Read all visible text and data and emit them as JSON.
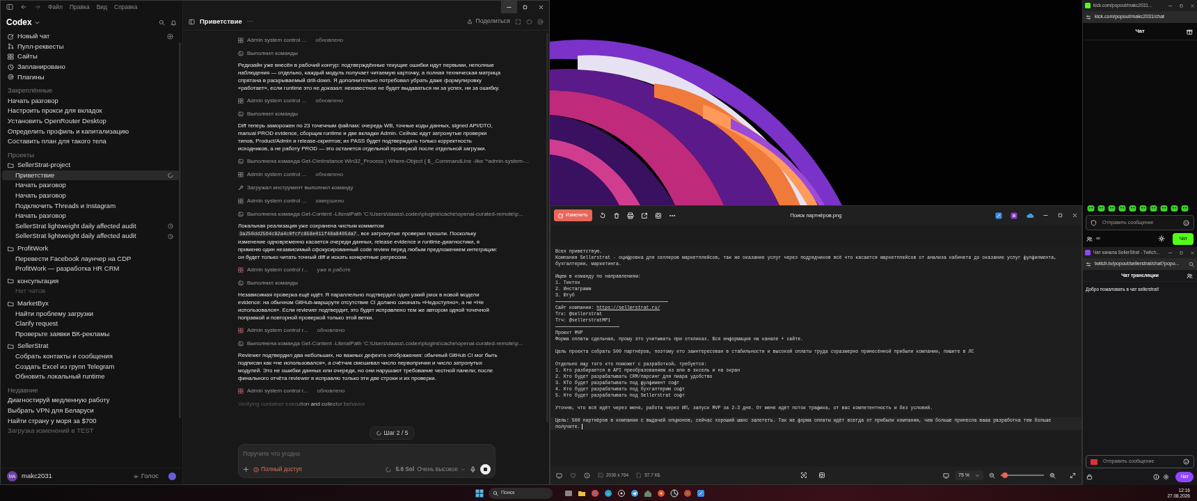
{
  "codex": {
    "menu": [
      "Файл",
      "Правка",
      "Вид",
      "Справка"
    ],
    "app_title": "Codex",
    "nav": [
      "Новый чат",
      "Пулл-реквесты",
      "Сайты",
      "Запланировано",
      "Плагины"
    ],
    "pinned": {
      "heading": "Закреплённые",
      "items": [
        {
          "label": "Начать разговор",
          "selected": false
        },
        {
          "label": "Настроить прокси для вкладок",
          "selected": false
        },
        {
          "label": "Установить OpenRouter Desktop",
          "selected": false
        },
        {
          "label": "Определить профиль и капитализацию",
          "selected": false
        },
        {
          "label": "Составить план для такого тела",
          "selected": false
        }
      ]
    },
    "projects": {
      "heading": "Проекты",
      "folders": [
        {
          "name": "SellerStrat-project",
          "children": [
            {
              "label": "Приветствие",
              "kind": "running",
              "selected": true
            },
            {
              "label": "Начать разговор",
              "kind": "chat",
              "selected": false
            },
            {
              "label": "Начать разговор",
              "kind": "chat",
              "selected": false
            },
            {
              "label": "Подключить Threads и Instagram",
              "kind": "chat",
              "selected": false
            },
            {
              "label": "Начать разговор",
              "kind": "chat",
              "selected": false
            },
            {
              "label": "SellerStrat lightweight daily affected audit",
              "kind": "scheduled",
              "selected": false
            },
            {
              "label": "SellerStrat lightweight daily affected audit",
              "kind": "scheduled",
              "selected": false
            }
          ]
        },
        {
          "name": "ProfitWork",
          "children": [
            {
              "label": "Перевести Facebook лаунчер на CDP",
              "kind": "chat",
              "selected": false
            },
            {
              "label": "ProfitWork — разработка HR CRM",
              "kind": "chat",
              "selected": false
            }
          ]
        },
        {
          "name": "консультация",
          "children": [
            {
              "label": "Нет чатов",
              "kind": "empty",
              "selected": false
            }
          ]
        },
        {
          "name": "MarketByx",
          "children": [
            {
              "label": "Найти проблему загрузки",
              "kind": "chat",
              "selected": false
            },
            {
              "label": "Clarify request",
              "kind": "chat",
              "selected": false
            },
            {
              "label": "Проверьте заявки ВК-рекламы",
              "kind": "chat",
              "selected": false
            }
          ]
        },
        {
          "name": "SellerStrat",
          "children": [
            {
              "label": "Собрать контакты и сообщения",
              "kind": "chat",
              "selected": false
            },
            {
              "label": "Создать Excel из групп Telegram",
              "kind": "chat",
              "selected": false
            },
            {
              "label": "Обновить локальный runtime",
              "kind": "chat",
              "selected": false
            }
          ]
        }
      ]
    },
    "recent": {
      "heading": "Недавние",
      "items": [
        {
          "label": "Диагностируй медленную работу",
          "kind": "chat",
          "selected": false
        },
        {
          "label": "Выбрать VPN для Беларуси",
          "kind": "chat",
          "selected": false
        },
        {
          "label": "Найти страну у моря за $700",
          "kind": "chat",
          "selected": false
        },
        {
          "label": "Загрузка изменений в TEST",
          "kind": "faded",
          "selected": false
        }
      ]
    },
    "user": {
      "initials": "MA",
      "name": "makc2031"
    },
    "voice": "Голос",
    "chat": {
      "title": "Приветствие",
      "more": "···",
      "share": "Поделиться",
      "messages": [
        {
          "kind": "tool",
          "label": "Admin system control ...",
          "status": "обновлено"
        },
        {
          "kind": "command",
          "label": "Выполнил команды"
        },
        {
          "kind": "text",
          "parts": [
            {
              "text": "Редизайн уже внесён в рабочий контур: подтверждённые текущие ошибки идут первыми, неполные наблюдения — отдельно, каждый модуль получает читаемую карточку, а полная техническая матрица спрятана в раскрываемый drill-down. Я дополнительно потребовал убрать даже формулировку «работает», если runtime это не доказал: неизвестное не будет выдаваться ни за успех, ни за ошибку.",
              "code": false
            }
          ]
        },
        {
          "kind": "tool",
          "label": "Admin system control ...",
          "status": "обновлено"
        },
        {
          "kind": "command",
          "label": "Выполнил команды"
        },
        {
          "kind": "text",
          "parts": [
            {
              "text": "Diff теперь заморожен по 23 точечным файлам: очередь WB, точные коды данных, signed API/DTO, manual PROD evidence, сборщик runtime и две вкладки Admin. Сейчас идут затронутые проверки типов, Product/Admin и release-скриптов; их PASS будет подтверждать только корректность исходников, а не работу PROD — это останется отдельной проверкой после отдельной загрузки.",
              "code": false
            }
          ]
        },
        {
          "kind": "command",
          "label": "Выполнена команда Get-CimInstance Win32_Process | Where-Object { $_.CommandLine -like '*admin-system-..."
        },
        {
          "kind": "tool",
          "label": "Admin system control ...",
          "status": "обновлено"
        },
        {
          "kind": "loader",
          "label": "Загружал инструмент выполнил команду"
        },
        {
          "kind": "tool",
          "label": "Admin system control ...",
          "status": "завершено"
        },
        {
          "kind": "command",
          "label": "Выполнена команда Get-Content -LiteralPath 'C:\\Users\\daass\\.codex\\plugins\\cache\\openai-curated-remote\\p..."
        },
        {
          "kind": "text",
          "parts": [
            {
              "text": "Локальная реализация уже сохранена чистым коммитом ",
              "code": false
            },
            {
              "text": "3a250dd2564c82a4c0fcfc858e011f48a8405da7",
              "code": true
            },
            {
              "text": ", все затронутые проверки прошли. Поскольку изменение одновременно касается очереди данных, release evidence и runtime-диагностики, я применю один независимый сфокусированный code review перед любым предложением интеграции: он будет только читать точный diff и искать конкретные регрессии.",
              "code": false
            }
          ]
        },
        {
          "kind": "tool",
          "label": "Admin system control r...",
          "status": "уже в работе"
        },
        {
          "kind": "command",
          "label": "Выполнил команды"
        },
        {
          "kind": "text",
          "parts": [
            {
              "text": "Независимая проверка ещё идёт. Я параллельно подтвердил один узкий риск в новой модели evidence: на обычном GitHub-маршруте отсутствие CI должно означать «Недоступно», а не «Не использовался». Если reviewer подтвердит, это будет исправлено тем же автором одной точечной поправкой и повторной проверкой только этой ветки.",
              "code": false
            }
          ]
        },
        {
          "kind": "tool",
          "label": "Admin system control r...",
          "status": "обновлено"
        },
        {
          "kind": "command",
          "label": "Выполнена команда Get-Content -LiteralPath 'C:\\Users\\daass\\.codex\\plugins\\cache\\openai-curated-remote\\p..."
        },
        {
          "kind": "text",
          "parts": [
            {
              "text": "Reviewer подтвердил два небольших, но важных дефекта отображения: обычный GitHub CI мог быть подписан как «не использовался», а счётчик смешивал число первопричин и число затронутых модулей. Это не ошибки данных или очереди, но они нарушают требование честной панели; после финального отчёта reviewer я исправлю только эти две строки и их проверки.",
              "code": false
            }
          ]
        },
        {
          "kind": "tool",
          "label": "Admin system control r...",
          "status": "обновлено"
        },
        {
          "kind": "status",
          "label": "Verifying container execution and collector behavior"
        }
      ],
      "step": "Шаг 2 / 5",
      "composer": {
        "placeholder": "Поручите что угодно",
        "access": "Полный доступ",
        "model": "5.6 Sol",
        "effort": "Очень высокое"
      }
    }
  },
  "photos": {
    "edit_button": "Изменить",
    "title": "Поиск партнёров.png",
    "blocks": [
      {
        "kind": "text",
        "lines": [
          {
            "text": "Всех приветствую."
          },
          {
            "text": "Компания Sellerstrat - оцифровка для селлеров маркетплейсов, так же оказание услуг через подрядчиков всё что касается маркетплейсов от анализа кабинета до оказание услуг фулфилмента, бухгалтерии, маркетинга."
          }
        ]
      },
      {
        "kind": "text",
        "lines": [
          {
            "text": "Ищем в команду по направлениям:"
          },
          {
            "text": "1. Тикток"
          },
          {
            "text": "2. Инстаграмм"
          },
          {
            "text": "3. Ютуб"
          }
        ]
      },
      {
        "kind": "rule"
      },
      {
        "kind": "text",
        "lines": [
          {
            "text": "Сайт компании: ",
            "link": "https://sellerstrat.ru/"
          },
          {
            "text": "Тгк: @sellerstrat"
          },
          {
            "text": "Тгч: @sellerstratMP1"
          }
        ]
      },
      {
        "kind": "rule"
      },
      {
        "kind": "text",
        "lines": [
          {
            "text": "Проект MVP"
          },
          {
            "text": "Форма оплаты сдельная, прошу это учитывать при откликах. Вся информация на канале + сайте."
          }
        ]
      },
      {
        "kind": "text",
        "lines": [
          {
            "text": "Цель проекта собрать 500 партнёров, поэтому кто заинтересован в стабильности и высокой оплаты труда соразмерно принесённой прибыли компании, пишите в ЛС"
          }
        ]
      },
      {
        "kind": "text",
        "lines": [
          {
            "text": "Отдельно ищу того кто поможет с разработкой, требуется:"
          },
          {
            "text": "1. Кто разбирается в API преобразованием из апи в эксель и на экран"
          },
          {
            "text": "2. Кто будет разрабатывать CRM/парсинг для пиара удобство"
          },
          {
            "text": "3. КТо будет разрабатывать под фулфимент софт"
          },
          {
            "text": "4. Кто будет разрабатывать под бухгалтерию софт"
          },
          {
            "text": "5. Кто будет разрабатывать под Sellerstrat софт"
          }
        ]
      },
      {
        "kind": "text",
        "lines": [
          {
            "text": "Уточню, что всё идёт через меня, работа через ИП, запуск MVP за 2-3 дня. От меня идёт поток трафика, от вас компетентность и без условий."
          }
        ]
      },
      {
        "kind": "current",
        "lines": [
          {
            "text": "Цель: 500 партнёров в компании с выдачей опционов, сейчас хороший шанс залететь. Так же форма оплаты идёт всегда от прибыли компании, чем больше принесла ваша разработка тем больше получите."
          }
        ]
      }
    ],
    "dimensions": "2030 x 764",
    "size": "57.7 КБ",
    "zoom": "75 %",
    "zoom_slider": {
      "level": 0.1
    }
  },
  "kick": {
    "title": "kick.com/popout/makc2031...",
    "address": "kick.com/popout/makc2031/chat",
    "header": "Чат",
    "placeholder": "Отправить сообщение",
    "viewers": "∞",
    "send": "Чат"
  },
  "twitch": {
    "title": "Чат канала SellerStrat - Twitch...",
    "address": "twitch.tv/popout/sellerstrat/chat?popo...",
    "header": "Чат трансляции",
    "message": "Добро пожаловать в чат sellerstrat!",
    "placeholder": "Отправить сообщение",
    "send": "Чат"
  },
  "taskbar": {
    "search": "Поиск",
    "time": "12:16",
    "date": "27.08.2026"
  }
}
